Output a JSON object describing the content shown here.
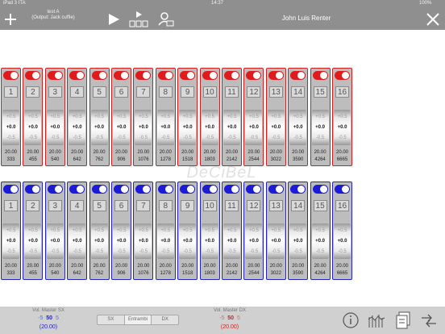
{
  "status_bar": {
    "carrier": "iPad 3 ITA",
    "time": "14:37",
    "battery": "100%"
  },
  "header": {
    "project_name": "test A",
    "project_output": "(Output: Jack cuffie)",
    "user_name": "John Luis Renter",
    "icons": [
      "plus-icon",
      "play-icon",
      "play-sequence-icon",
      "user-settings-icon",
      "close-icon"
    ]
  },
  "watermark": "DeCiBeL",
  "colors": {
    "top_bank": "#e11b1b",
    "bottom_bank": "#1c1cd8",
    "bar_bg": "#8f8f8f"
  },
  "channels": [
    {
      "num": "1",
      "gain": "20.00",
      "freq": "333"
    },
    {
      "num": "2",
      "gain": "20.00",
      "freq": "455"
    },
    {
      "num": "3",
      "gain": "20.00",
      "freq": "540"
    },
    {
      "num": "4",
      "gain": "20.00",
      "freq": "642"
    },
    {
      "num": "5",
      "gain": "20.00",
      "freq": "762"
    },
    {
      "num": "6",
      "gain": "20.00",
      "freq": "906"
    },
    {
      "num": "7",
      "gain": "20.00",
      "freq": "1076"
    },
    {
      "num": "8",
      "gain": "20.00",
      "freq": "1278"
    },
    {
      "num": "9",
      "gain": "20.00",
      "freq": "1518"
    },
    {
      "num": "10",
      "gain": "20.00",
      "freq": "1803"
    },
    {
      "num": "11",
      "gain": "20.00",
      "freq": "2142"
    },
    {
      "num": "12",
      "gain": "20.00",
      "freq": "2544"
    },
    {
      "num": "13",
      "gain": "20.00",
      "freq": "3022"
    },
    {
      "num": "14",
      "gain": "20.00",
      "freq": "3590"
    },
    {
      "num": "15",
      "gain": "20.00",
      "freq": "4264"
    },
    {
      "num": "16",
      "gain": "20.00",
      "freq": "6665"
    }
  ],
  "wheel": {
    "plus": "+0.5",
    "zero": "+0.0",
    "minus": "-0.5"
  },
  "footer": {
    "vol_sx": {
      "title": "Vol. Master SX",
      "minus": "-5",
      "value": "50",
      "plus": "5",
      "current": "(20.00)"
    },
    "vol_dx": {
      "title": "Vol. Master DX",
      "minus": "-5",
      "value": "50",
      "plus": "5",
      "current": "(20.00)"
    },
    "segment": [
      "SX",
      "Entrambi",
      "DX"
    ],
    "segment_selected": "Entrambi",
    "icons": [
      "info-icon",
      "equalizer-icon",
      "documents-icon",
      "swap-icon"
    ]
  }
}
